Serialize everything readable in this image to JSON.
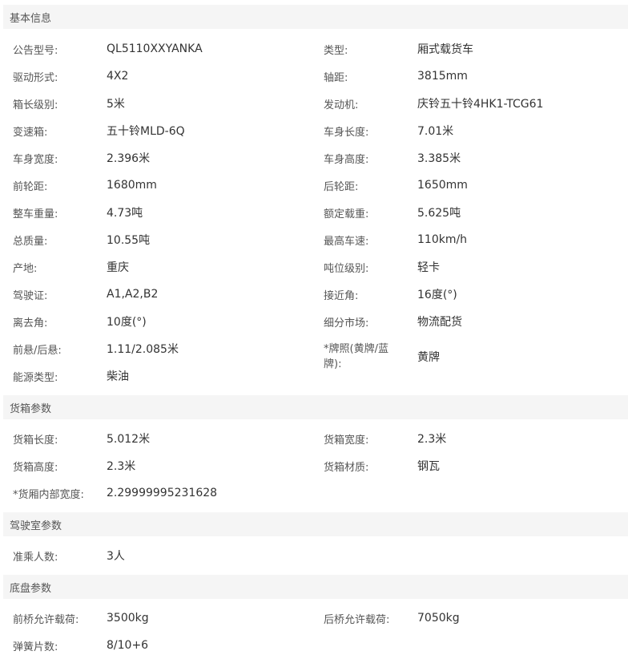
{
  "sections": [
    {
      "title": "基本信息",
      "rows": [
        [
          "公告型号:",
          "QL5110XXYANKA",
          "类型:",
          "厢式载货车"
        ],
        [
          "驱动形式:",
          "4X2",
          "轴距:",
          "3815mm"
        ],
        [
          "箱长级别:",
          "5米",
          "发动机:",
          "庆铃五十铃4HK1-TCG61"
        ],
        [
          "变速箱:",
          "五十铃MLD-6Q",
          "车身长度:",
          "7.01米"
        ],
        [
          "车身宽度:",
          "2.396米",
          "车身高度:",
          "3.385米"
        ],
        [
          "前轮距:",
          "1680mm",
          "后轮距:",
          "1650mm"
        ],
        [
          "整车重量:",
          "4.73吨",
          "额定载重:",
          "5.625吨"
        ],
        [
          "总质量:",
          "10.55吨",
          "最高车速:",
          "110km/h"
        ],
        [
          "产地:",
          "重庆",
          "吨位级别:",
          "轻卡"
        ],
        [
          "驾驶证:",
          "A1,A2,B2",
          "接近角:",
          "16度(°)"
        ],
        [
          "离去角:",
          "10度(°)",
          "细分市场:",
          "物流配货"
        ],
        [
          "前悬/后悬:",
          "1.11/2.085米",
          "*牌照(黄牌/蓝牌):",
          "黄牌"
        ],
        [
          "能源类型:",
          "柴油",
          "",
          ""
        ]
      ]
    },
    {
      "title": "货箱参数",
      "rows": [
        [
          "货箱长度:",
          "5.012米",
          "货箱宽度:",
          "2.3米"
        ],
        [
          "货箱高度:",
          "2.3米",
          "货箱材质:",
          "钢瓦"
        ],
        [
          "*货厢内部宽度:",
          "2.29999995231628",
          "",
          ""
        ]
      ]
    },
    {
      "title": "驾驶室参数",
      "rows": [
        [
          "准乘人数:",
          "3人",
          "",
          ""
        ]
      ]
    },
    {
      "title": "底盘参数",
      "rows": [
        [
          "前桥允许载荷:",
          "3500kg",
          "后桥允许载荷:",
          "7050kg"
        ],
        [
          "弹簧片数:",
          "8/10+6",
          "",
          ""
        ]
      ]
    }
  ]
}
